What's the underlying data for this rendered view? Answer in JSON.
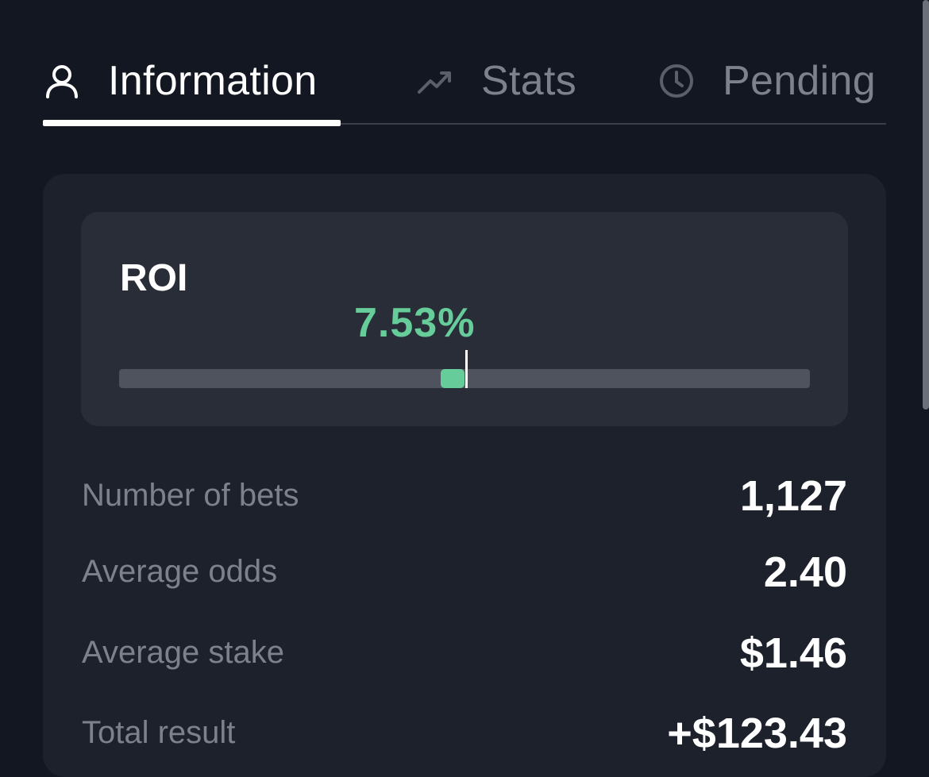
{
  "tabs": [
    {
      "label": "Information",
      "icon": "user-icon",
      "active": true
    },
    {
      "label": "Stats",
      "icon": "trending-up-icon",
      "active": false
    },
    {
      "label": "Pending",
      "icon": "clock-icon",
      "active": false
    }
  ],
  "roi": {
    "title": "ROI",
    "value_text": "7.53%",
    "value": 7.53,
    "bar_center_fraction": 0.5
  },
  "stats": [
    {
      "label": "Number of bets",
      "value": "1,127"
    },
    {
      "label": "Average odds",
      "value": "2.40"
    },
    {
      "label": "Average stake",
      "value": "$1.46"
    },
    {
      "label": "Total result",
      "value": "+$123.43"
    }
  ],
  "colors": {
    "background": "#121722",
    "card": "#1c212c",
    "roi_box": "#282d38",
    "accent_green": "#66cc99",
    "muted_text": "#7c818c"
  }
}
